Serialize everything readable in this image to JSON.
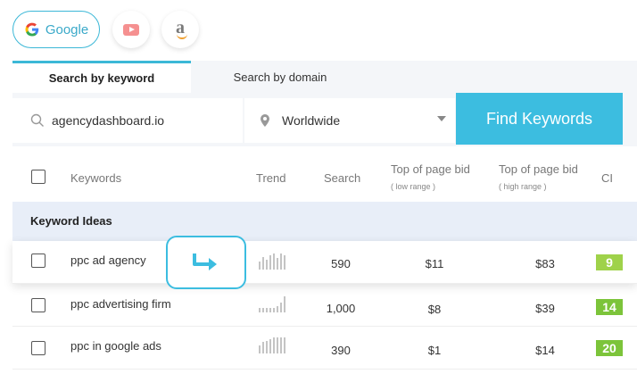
{
  "engines": {
    "google_label": "Google"
  },
  "tabs": {
    "keyword": "Search by keyword",
    "domain": "Search by domain"
  },
  "search": {
    "keyword_value": "agencydashboard.io",
    "location": "Worldwide",
    "find_button": "Find Keywords"
  },
  "table": {
    "headers": {
      "keywords": "Keywords",
      "trend": "Trend",
      "search": "Search",
      "bid_low": "Top of page bid",
      "bid_low_sub": "( low range )",
      "bid_high": "Top of page bid",
      "bid_high_sub": "( high range )",
      "ci": "CI"
    },
    "section_label": "Keyword Ideas",
    "rows": [
      {
        "keyword": "ppc ad agency",
        "search": "590",
        "bid_low": "$11",
        "bid_high": "$83",
        "ci": "9",
        "trend": [
          0.5,
          0.8,
          0.6,
          0.9,
          1.0,
          0.7,
          1.0,
          0.9
        ]
      },
      {
        "keyword": "ppc advertising firm",
        "search": "1,000",
        "bid_low": "$8",
        "bid_high": "$39",
        "ci": "14",
        "trend": [
          0.3,
          0.3,
          0.3,
          0.3,
          0.3,
          0.4,
          0.6,
          1.0
        ]
      },
      {
        "keyword": "ppc in google ads",
        "search": "390",
        "bid_low": "$1",
        "bid_high": "$14",
        "ci": "20",
        "trend": [
          0.5,
          0.7,
          0.8,
          0.9,
          1.0,
          1.0,
          1.0,
          1.0
        ]
      }
    ]
  },
  "colors": {
    "accent": "#3cbde0",
    "ci_light": "#9fd24a",
    "ci_dark": "#7cc43a"
  }
}
